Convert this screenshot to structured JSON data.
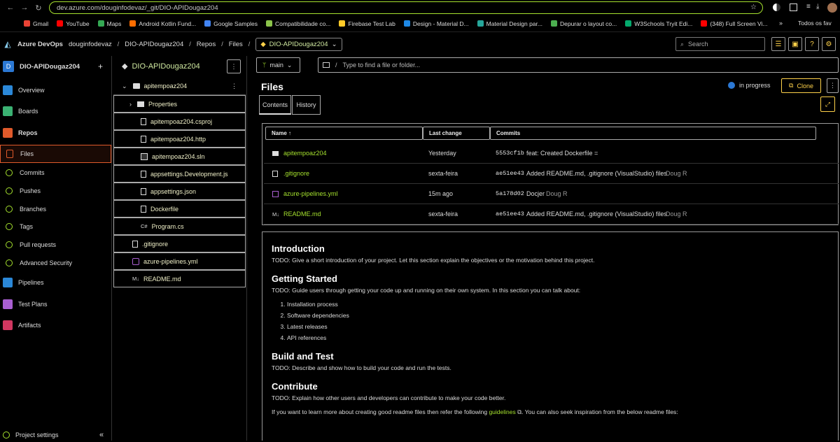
{
  "browser": {
    "url": "dev.azure.com/douginfodevaz/_git/DIO-APIDougaz204",
    "bookmarks": [
      {
        "label": "Gmail",
        "color": "#ea4335"
      },
      {
        "label": "YouTube",
        "color": "#ff0000"
      },
      {
        "label": "Maps",
        "color": "#34a853"
      },
      {
        "label": "Android Kotlin Fund...",
        "color": "#ff6d00"
      },
      {
        "label": "Google Samples",
        "color": "#4285f4"
      },
      {
        "label": "Compatibilidade co...",
        "color": "#8bc34a"
      },
      {
        "label": "Firebase Test Lab",
        "color": "#ffca28"
      },
      {
        "label": "Design - Material D...",
        "color": "#1e88e5"
      },
      {
        "label": "Material Design par...",
        "color": "#26a69a"
      },
      {
        "label": "Depurar o layout co...",
        "color": "#4caf50"
      },
      {
        "label": "W3Schools Tryit Edi...",
        "color": "#04aa6d"
      },
      {
        "label": "(348) Full Screen Vi...",
        "color": "#ff0000"
      }
    ],
    "all_bookmarks": "Todos os fav"
  },
  "header": {
    "brand": "Azure DevOps",
    "org": "douginfodevaz",
    "project": "DIO-APIDougaz204",
    "repos": "Repos",
    "files": "Files",
    "repo": "DIO-APIDougaz204",
    "search_placeholder": "Search"
  },
  "sidebar": {
    "project": "DIO-APIDougaz204",
    "project_initial": "D",
    "items": [
      {
        "label": "Overview",
        "color": "#2b88d8"
      },
      {
        "label": "Boards",
        "color": "#3bb273"
      },
      {
        "label": "Repos",
        "color": "#e05a2b"
      },
      {
        "label": "Files",
        "color": "#e05a2b"
      },
      {
        "label": "Commits",
        "color": "#a6e22e"
      },
      {
        "label": "Pushes",
        "color": "#a6e22e"
      },
      {
        "label": "Branches",
        "color": "#a6e22e"
      },
      {
        "label": "Tags",
        "color": "#a6e22e"
      },
      {
        "label": "Pull requests",
        "color": "#a6e22e"
      },
      {
        "label": "Advanced Security",
        "color": "#a6e22e"
      },
      {
        "label": "Pipelines",
        "color": "#2b88d8"
      },
      {
        "label": "Test Plans",
        "color": "#a95fd1"
      },
      {
        "label": "Artifacts",
        "color": "#d13760"
      }
    ],
    "settings": "Project settings",
    "collapse": "«"
  },
  "tree": {
    "title": "DIO-APIDougaz204",
    "root": "apitempoaz204",
    "items": [
      {
        "label": "Properties",
        "icon": "folder"
      },
      {
        "label": "apitempoaz204.csproj",
        "icon": "file"
      },
      {
        "label": "apitempoaz204.http",
        "icon": "file"
      },
      {
        "label": "apitempoaz204.sln",
        "icon": "solution"
      },
      {
        "label": "appsettings.Development.js",
        "icon": "file"
      },
      {
        "label": "appsettings.json",
        "icon": "file"
      },
      {
        "label": "Dockerfile",
        "icon": "file"
      },
      {
        "label": "Program.cs",
        "icon": "csharp",
        "prefix": "C#"
      },
      {
        "label": ".gitignore",
        "icon": "file"
      },
      {
        "label": "azure-pipelines.yml",
        "icon": "pipeline"
      },
      {
        "label": "README.md",
        "icon": "markdown",
        "prefix": "M↓"
      }
    ]
  },
  "main": {
    "branch": "main",
    "path_placeholder": "Type to find a file or folder...",
    "path_sep": "/",
    "title": "Files",
    "status": "in progress",
    "clone": "Clone",
    "tabs": [
      "Contents",
      "History"
    ],
    "columns": [
      "Name ↑",
      "Last change",
      "Commits"
    ],
    "files": [
      {
        "name": "apitempoaz204",
        "icon": "folder",
        "last": "Yesterday",
        "hash": "5553cf1b",
        "msg": "feat: Created Dockerfile =",
        "author": ""
      },
      {
        "name": ".gitignore",
        "icon": "file",
        "last": "sexta-feira",
        "hash": "ae51ee43",
        "msg": "Added README.md, .gitignore (VisualStudio) files",
        "author": "Doug R"
      },
      {
        "name": "azure-pipelines.yml",
        "icon": "pipeline",
        "last": "15m ago",
        "hash": "5a178d02",
        "msg": "Docjer",
        "author": "Doug R"
      },
      {
        "name": "README.md",
        "icon": "markdown",
        "last": "sexta-feira",
        "hash": "ae51ee43",
        "msg": "Added README.md, .gitignore (VisualStudio) files",
        "author": "Doug R"
      }
    ]
  },
  "readme": {
    "h_intro": "Introduction",
    "p_intro": "TODO: Give a short introduction of your project. Let this section explain the objectives or the motivation behind this project.",
    "h_start": "Getting Started",
    "p_start": "TODO: Guide users through getting your code up and running on their own system. In this section you can talk about:",
    "steps": [
      "Installation process",
      "Software dependencies",
      "Latest releases",
      "API references"
    ],
    "h_build": "Build and Test",
    "p_build": "TODO: Describe and show how to build your code and run the tests.",
    "h_contrib": "Contribute",
    "p_contrib": "TODO: Explain how other users and developers can contribute to make your code better.",
    "p_more_a": "If you want to learn more about creating good readme files then refer the following",
    "link": "guidelines",
    "p_more_b": ". You can also seek inspiration from the below readme files:"
  }
}
